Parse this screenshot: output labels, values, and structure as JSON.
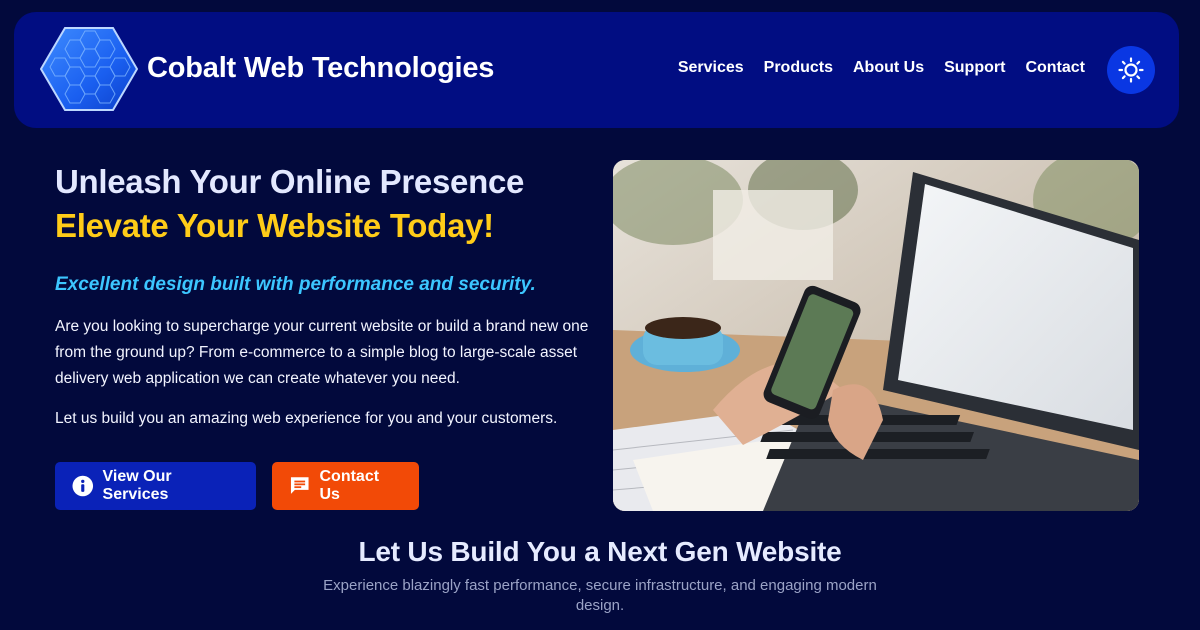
{
  "brand": {
    "name": "Cobalt Web Technologies",
    "logo_icon": "hexagon-logo-icon"
  },
  "nav": {
    "items": [
      "Services",
      "Products",
      "About Us",
      "Support",
      "Contact"
    ],
    "theme_toggle_icon": "sun-icon"
  },
  "hero": {
    "title_line1": "Unleash Your Online Presence",
    "title_line2": "Elevate Your Website Today!",
    "tagline": "Excellent design built with performance and security.",
    "paragraph1": "Are you looking to supercharge your current website or build a brand new one from the ground up? From e-commerce to a simple blog to large-scale asset delivery web application we can create whatever you need.",
    "paragraph2": "Let us build you an amazing web experience for you and your customers.",
    "primary_button": {
      "label": "View Our Services",
      "icon": "info-icon"
    },
    "secondary_button": {
      "label": "Contact Us",
      "icon": "chat-icon"
    }
  },
  "section": {
    "title": "Let Us Build You a Next Gen Website",
    "subtitle": "Experience blazingly fast performance, secure infrastructure, and engaging modern design."
  },
  "colors": {
    "page_bg": "#02093c",
    "navbar_bg": "#010d82",
    "accent_yellow": "#ffcc18",
    "accent_cyan": "#3cc6ff",
    "button_blue": "#0a22b8",
    "button_orange": "#f24a07"
  }
}
